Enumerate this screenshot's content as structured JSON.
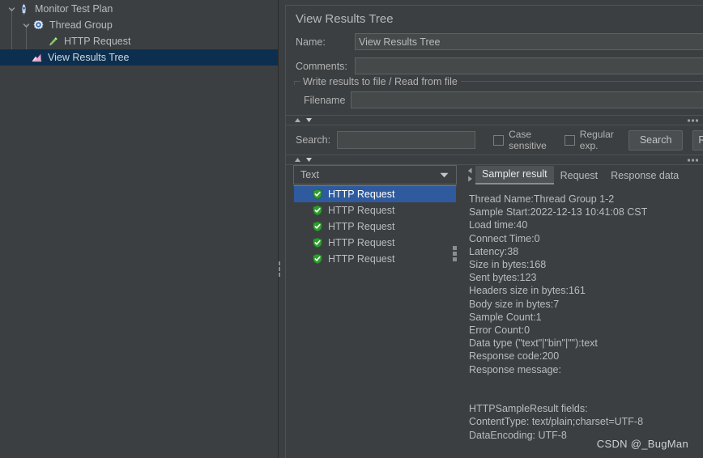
{
  "sidebar": {
    "items": [
      {
        "label": "Monitor Test Plan",
        "icon": "test-plan-icon",
        "indent": 0,
        "twisty": "expanded",
        "selected": false
      },
      {
        "label": "Thread Group",
        "icon": "gear-icon",
        "indent": 1,
        "twisty": "expanded",
        "selected": false
      },
      {
        "label": "HTTP Request",
        "icon": "pen-icon",
        "indent": 2,
        "twisty": "none",
        "selected": false
      },
      {
        "label": "View Results Tree",
        "icon": "chart-icon",
        "indent": 2,
        "twisty": "none",
        "selected": true
      }
    ]
  },
  "main": {
    "title": "View Results Tree",
    "name_label": "Name:",
    "name_value": "View Results Tree",
    "comments_label": "Comments:",
    "comments_value": "",
    "comments_placeholder": "",
    "group_legend": "Write results to file / Read from file",
    "filename_label": "Filename",
    "filename_value": "",
    "filename_placeholder": ""
  },
  "search": {
    "label": "Search:",
    "value": "",
    "placeholder": "",
    "case_sensitive_label": "Case sensitive",
    "regular_exp_label": "Regular exp.",
    "search_button": "Search",
    "reset_button": "R"
  },
  "results": {
    "renderer_selected": "Text",
    "items": [
      {
        "label": "HTTP Request",
        "status": "success",
        "selected": true
      },
      {
        "label": "HTTP Request",
        "status": "success",
        "selected": false
      },
      {
        "label": "HTTP Request",
        "status": "success",
        "selected": false
      },
      {
        "label": "HTTP Request",
        "status": "success",
        "selected": false
      },
      {
        "label": "HTTP Request",
        "status": "success",
        "selected": false
      }
    ],
    "tabs": [
      {
        "label": "Sampler result",
        "active": true
      },
      {
        "label": "Request",
        "active": false
      },
      {
        "label": "Response data",
        "active": false
      }
    ],
    "sampler_result_text": "Thread Name:Thread Group 1-2\nSample Start:2022-12-13 10:41:08 CST\nLoad time:40\nConnect Time:0\nLatency:38\nSize in bytes:168\nSent bytes:123\nHeaders size in bytes:161\nBody size in bytes:7\nSample Count:1\nError Count:0\nData type (\"text\"|\"bin\"|\"\"):text\nResponse code:200\nResponse message:\n\n\nHTTPSampleResult fields:\nContentType: text/plain;charset=UTF-8\nDataEncoding: UTF-8"
  },
  "watermark": "CSDN @_BugMan",
  "colors": {
    "background": "#3c3f41",
    "tree_selection": "#0d2f4f",
    "list_selection": "#2f5b9e",
    "success_green": "#4aa02c",
    "accent_blue": "#4a86c8",
    "text": "#b9bcbe"
  }
}
